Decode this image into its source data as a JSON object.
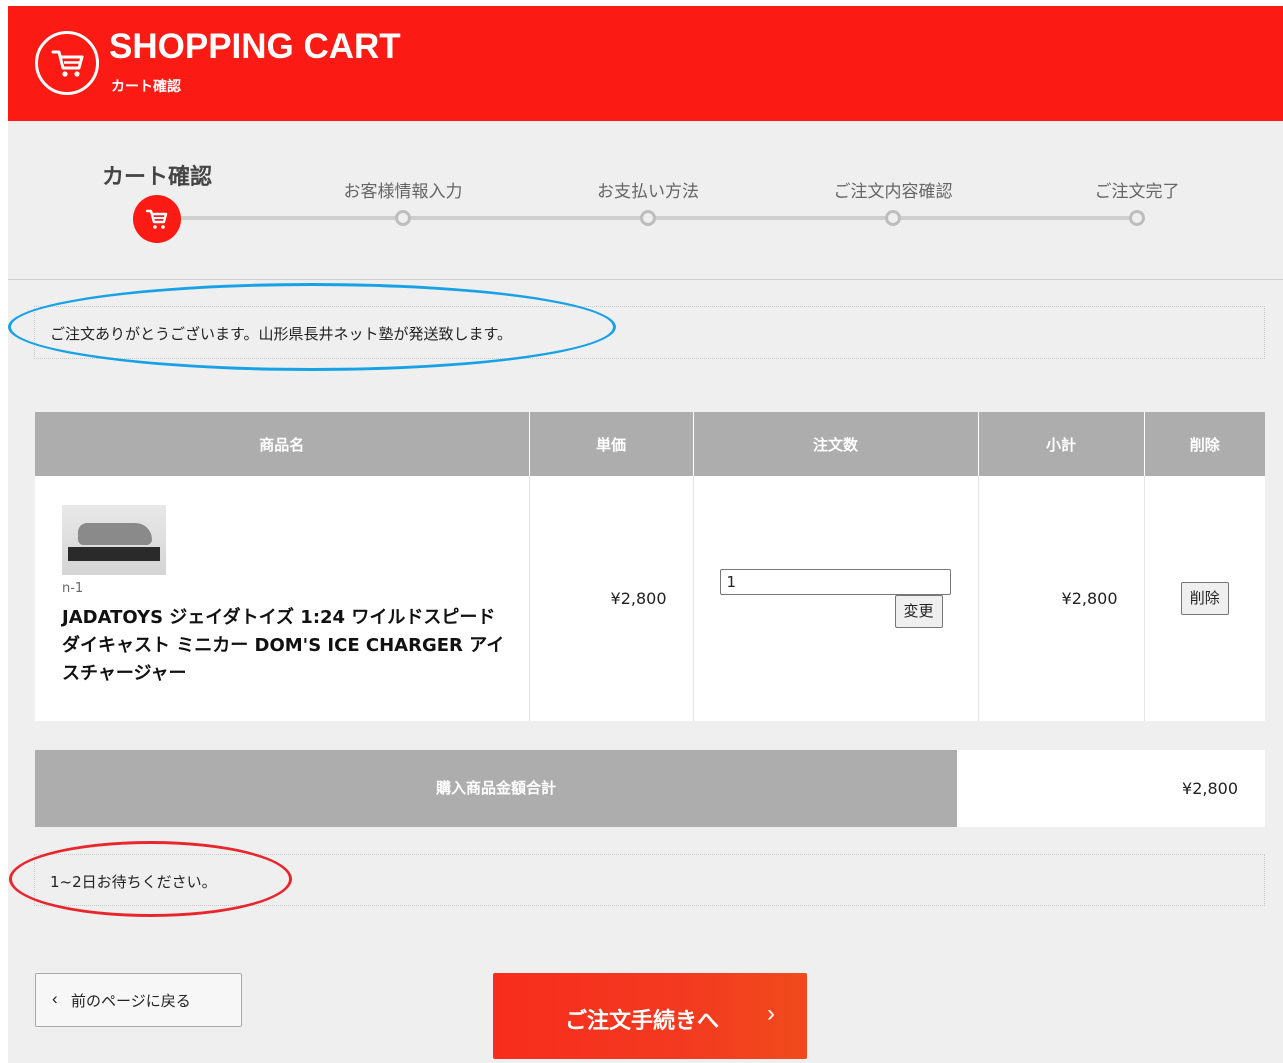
{
  "header": {
    "title": "SHOPPING CART",
    "subtitle": "カート確認"
  },
  "steps": [
    {
      "label": "カート確認",
      "active": true
    },
    {
      "label": "お客様情報入力",
      "active": false
    },
    {
      "label": "お支払い方法",
      "active": false
    },
    {
      "label": "ご注文内容確認",
      "active": false
    },
    {
      "label": "ご注文完了",
      "active": false
    }
  ],
  "notice": {
    "message": "ご注文ありがとうございます。山形県長井ネット塾が発送致します。"
  },
  "table": {
    "headers": {
      "name": "商品名",
      "price": "単価",
      "quantity": "注文数",
      "subtotal": "小計",
      "delete": "削除"
    },
    "row": {
      "code": "n-1",
      "name": "JADATOYS ジェイダトイズ 1:24 ワイルドスピード ダイキャスト ミニカー DOM'S ICE CHARGER アイスチャージャー",
      "price": "¥2,800",
      "quantity": "1",
      "change_label": "変更",
      "subtotal": "¥2,800",
      "delete_label": "削除"
    }
  },
  "total": {
    "label": "購入商品金額合計",
    "value": "¥2,800"
  },
  "wait": {
    "message": "1~2日お待ちください。"
  },
  "buttons": {
    "back_label": "前のページに戻る",
    "order_label": "ご注文手続きへ"
  },
  "colors": {
    "brand_red": "#fb1a14",
    "annotation_blue": "#17a2e6",
    "annotation_red": "#e8262d",
    "header_gray": "#adadad"
  }
}
